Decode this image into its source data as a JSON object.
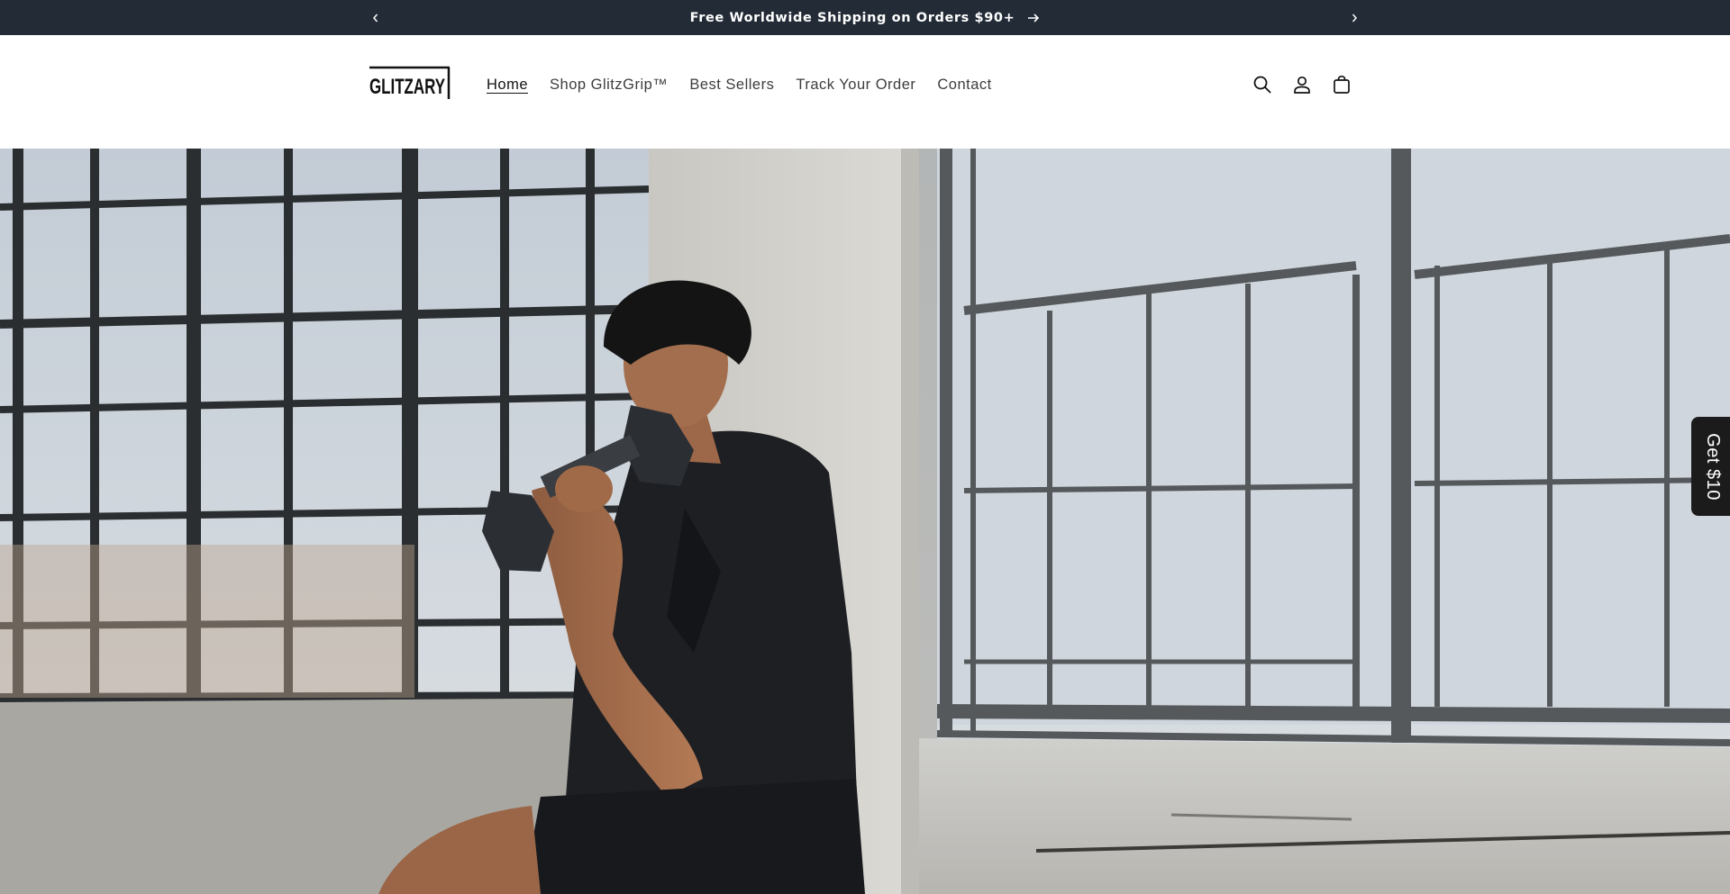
{
  "announcement": {
    "text": "Free Worldwide Shipping on Orders $90+",
    "prev_icon": "chevron-left-icon",
    "next_icon": "chevron-right-icon",
    "link_icon": "arrow-right-icon"
  },
  "header": {
    "logo_text": "GLITZARY",
    "nav": [
      {
        "label": "Home",
        "active": true
      },
      {
        "label": "Shop GlitzGrip™",
        "active": false
      },
      {
        "label": "Best Sellers",
        "active": false
      },
      {
        "label": "Track Your Order",
        "active": false
      },
      {
        "label": "Contact",
        "active": false
      }
    ],
    "icons": [
      "search-icon",
      "account-icon",
      "cart-icon"
    ]
  },
  "hero": {
    "image": "man-lifting-dumbbell-by-loft-windows"
  },
  "side_tab": {
    "label": "Get $10"
  },
  "colors": {
    "announcement_bg": "#222b36",
    "side_tab_bg": "#1b1b1b",
    "text_dark": "#121212"
  }
}
